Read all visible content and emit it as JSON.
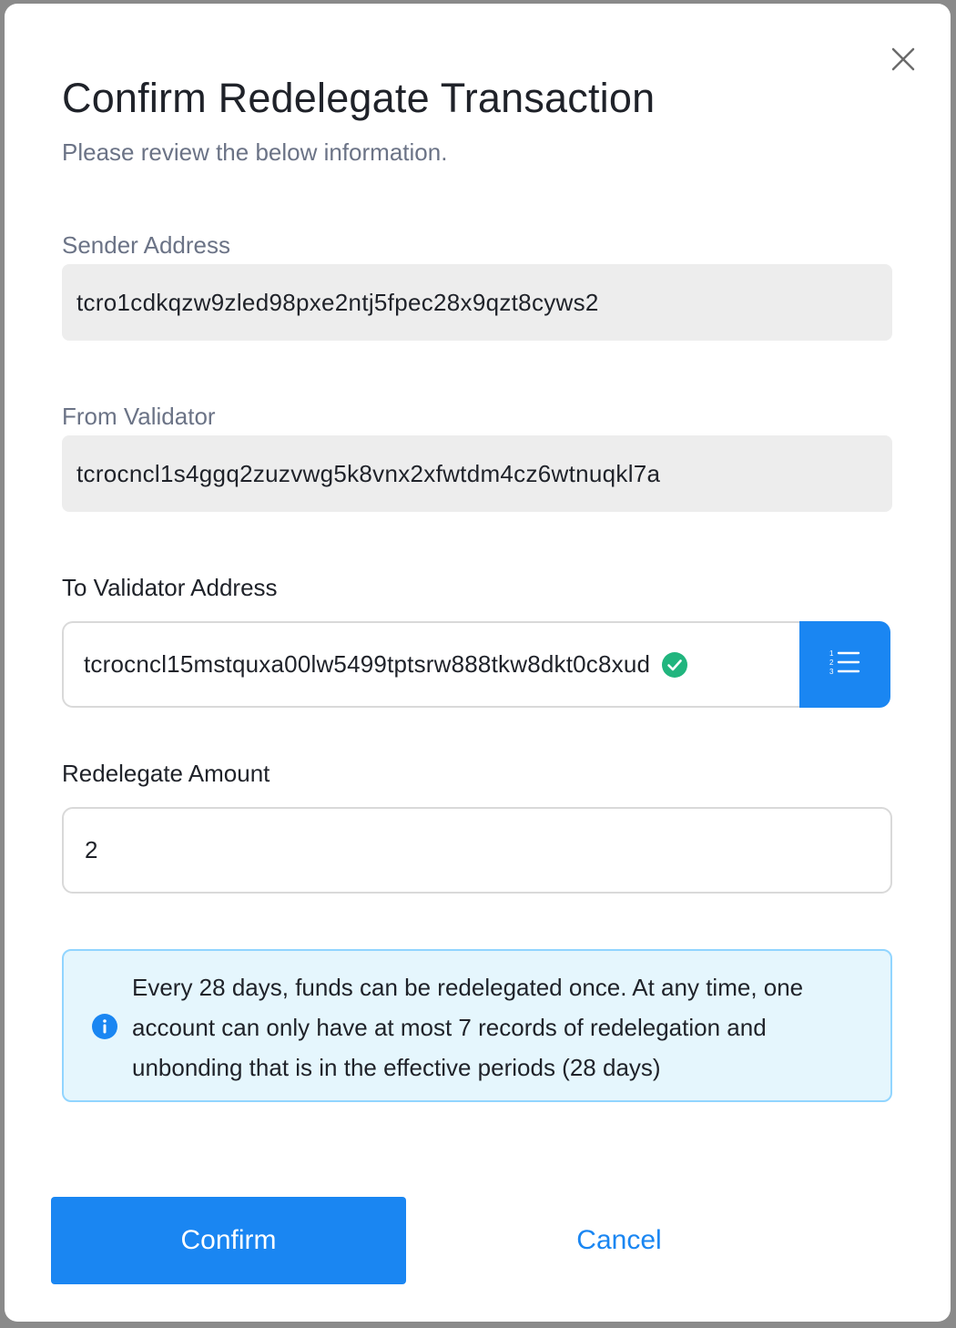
{
  "modal": {
    "title": "Confirm Redelegate Transaction",
    "subtitle": "Please review the below information."
  },
  "sender": {
    "label": "Sender Address",
    "value": "tcro1cdkqzw9zled98pxe2ntj5fpec28x9qzt8cyws2"
  },
  "from_validator": {
    "label": "From Validator",
    "value": "tcrocncl1s4ggq2zuzvwg5k8vnx2xfwtdm4cz6wtnuqkl7a"
  },
  "to_validator": {
    "label": "To Validator Address",
    "value": "tcrocncl15mstquxa00lw5499tptsrw888tkw8dkt0c8xud",
    "valid_icon": "check-circle-icon",
    "list_icon": "ordered-list-icon"
  },
  "amount": {
    "label": "Redelegate Amount",
    "value": "2"
  },
  "alert": {
    "icon": "info-circle-icon",
    "message": "Every 28 days, funds can be redelegated once. At any time, one account can only have at most 7 records of redelegation and unbonding that is in the effective periods (28 days)"
  },
  "actions": {
    "confirm_label": "Confirm",
    "cancel_label": "Cancel"
  },
  "colors": {
    "primary": "#1a86f2",
    "success": "#21b57e",
    "alert_bg": "#e5f6fd",
    "alert_border": "#91d5ff"
  }
}
